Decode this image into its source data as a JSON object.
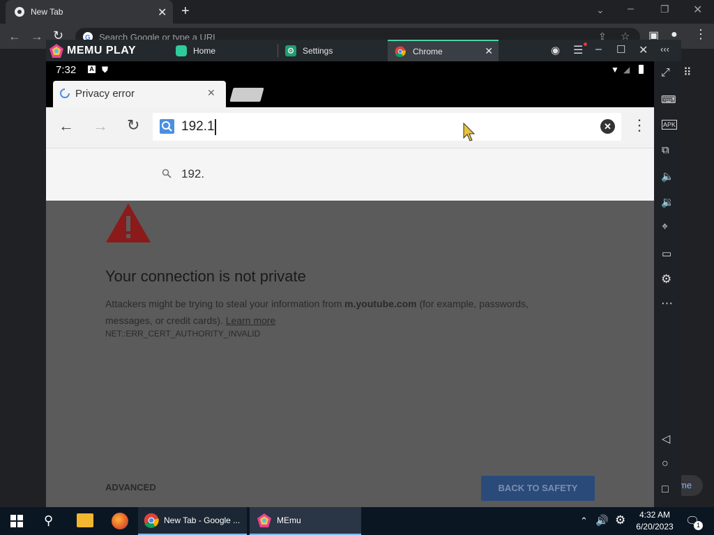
{
  "host_browser": {
    "tab_title": "New Tab",
    "omnibox_placeholder": "Search Google or type a URL"
  },
  "memu": {
    "brand": "MEMU PLAY",
    "tabs": [
      {
        "label": "Home"
      },
      {
        "label": "Settings"
      },
      {
        "label": "Chrome"
      }
    ],
    "more_glyph": "‹‹‹"
  },
  "android": {
    "time": "7:32",
    "chrome": {
      "tab_title": "Privacy error",
      "url_value": "192.1",
      "suggestion": "192."
    },
    "error_page": {
      "heading": "Your connection is not private",
      "body_prefix": "Attackers might be trying to steal your information from ",
      "domain": "m.youtube.com",
      "body_suffix": " (for example, passwords, messages, or credit cards). ",
      "learn_more": "Learn more",
      "error_code": "NET::ERR_CERT_AUTHORITY_INVALID",
      "advanced": "ADVANCED",
      "back_to_safety": "BACK TO SAFETY"
    }
  },
  "partial_text": "me",
  "taskbar": {
    "chrome_label": "New Tab - Google ...",
    "memu_label": "MEmu",
    "time": "4:32 AM",
    "date": "6/20/2023",
    "notification_count": "1"
  },
  "colors": {
    "accent_blue": "#4a90e2",
    "warning_red": "#8b1a1a",
    "memu_tab_active": "#3a3f45"
  }
}
